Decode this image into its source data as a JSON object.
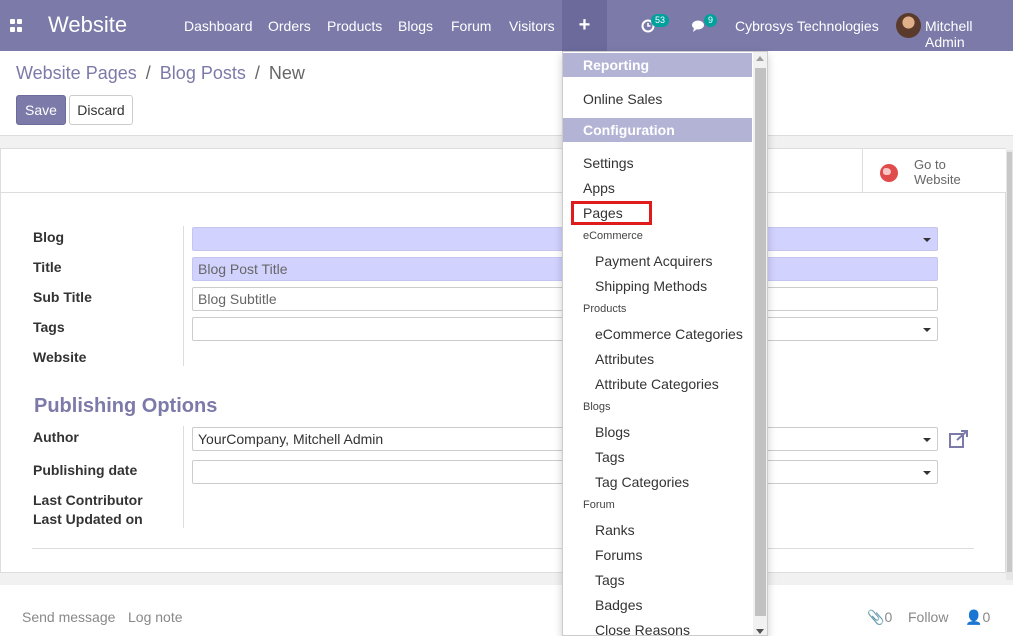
{
  "navbar": {
    "brand": "Website",
    "menu": [
      "Dashboard",
      "Orders",
      "Products",
      "Blogs",
      "Forum",
      "Visitors"
    ],
    "plus": "+",
    "activity_count": "53",
    "message_count": "9",
    "company": "Cybrosys Technologies",
    "user": "Mitchell Admin",
    "accent": "#7b7aa9"
  },
  "breadcrumb": {
    "items": [
      "Website Pages",
      "Blog Posts"
    ],
    "current": "New",
    "sep": "/"
  },
  "buttons": {
    "save": "Save",
    "discard": "Discard"
  },
  "button_box": {
    "goto_line1": "Go to",
    "goto_line2": "Website"
  },
  "form": {
    "blog_label": "Blog",
    "title_label": "Title",
    "title_placeholder": "Blog Post Title",
    "subtitle_label": "Sub Title",
    "subtitle_placeholder": "Blog Subtitle",
    "tags_label": "Tags",
    "website_label": "Website",
    "publishing_title": "Publishing Options",
    "author_label": "Author",
    "author_value": "YourCompany, Mitchell Admin",
    "pubdate_label": "Publishing date",
    "last_contributor_label": "Last Contributor",
    "last_updated_label": "Last Updated on"
  },
  "chatter": {
    "send_message": "Send message",
    "log_note": "Log note",
    "attachments": "0",
    "follow": "Follow",
    "followers": "0"
  },
  "dropdown": {
    "reporting": "Reporting",
    "online_sales": "Online Sales",
    "configuration": "Configuration",
    "settings": "Settings",
    "apps": "Apps",
    "pages": "Pages",
    "ecommerce": "eCommerce",
    "payment_acquirers": "Payment Acquirers",
    "shipping_methods": "Shipping Methods",
    "products": "Products",
    "ecommerce_categories": "eCommerce Categories",
    "attributes": "Attributes",
    "attribute_categories": "Attribute Categories",
    "blogs_group": "Blogs",
    "blogs": "Blogs",
    "tags": "Tags",
    "tag_categories": "Tag Categories",
    "forum": "Forum",
    "ranks": "Ranks",
    "forums": "Forums",
    "forum_tags": "Tags",
    "badges": "Badges",
    "close_reasons": "Close Reasons"
  }
}
